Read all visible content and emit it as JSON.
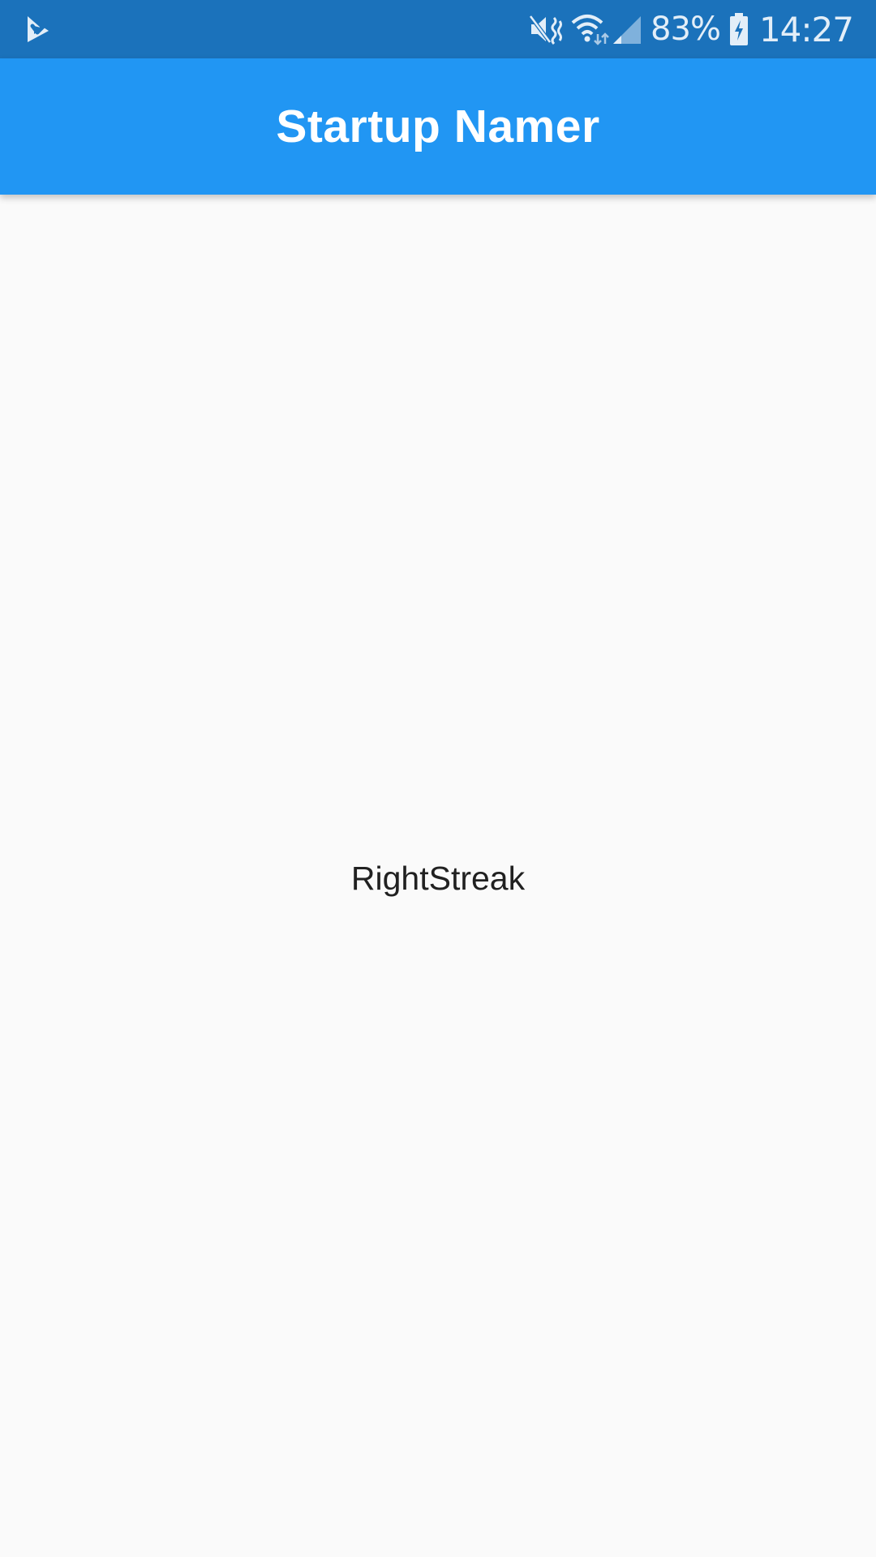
{
  "status_bar": {
    "battery_percent": "83%",
    "time": "14:27",
    "icons": [
      "checkmark-app-icon",
      "mute-icon",
      "wifi-icon",
      "signal-icon",
      "battery-charging-icon"
    ],
    "background_color": "#1b72bb"
  },
  "app_bar": {
    "title": "Startup Namer",
    "background_color": "#2196f3"
  },
  "main": {
    "generated_name": "RightStreak"
  }
}
